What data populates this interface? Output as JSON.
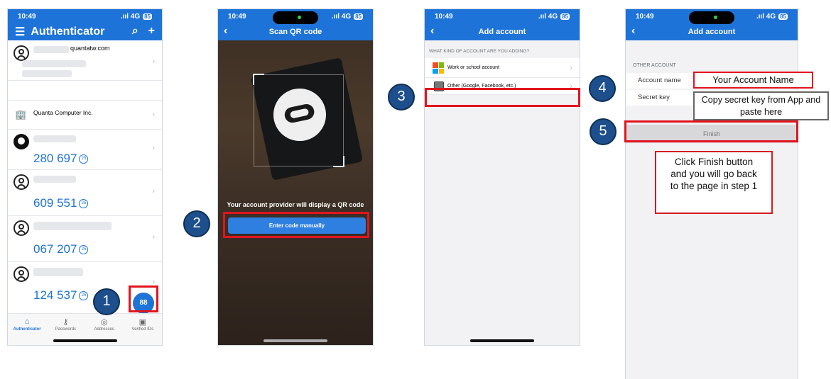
{
  "colors": {
    "brand_blue": "#1e73d8",
    "annotation_red": "#e1141e",
    "step_badge": "#1e4f8d"
  },
  "status": {
    "time": "10:49",
    "signal": ".ııl 4G",
    "battery": "85"
  },
  "phone1": {
    "title": "Authenticator",
    "icons": [
      "menu-icon",
      "search-icon",
      "add-icon"
    ],
    "accounts": [
      {
        "name_partial": "quantatw.com"
      },
      {
        "name": "Quanta Computer Inc."
      },
      {
        "code": "280 697",
        "timer": "25"
      },
      {
        "code": "609 551",
        "timer": "25"
      },
      {
        "code": "067 207",
        "timer": "25"
      },
      {
        "code": "124 537",
        "timer": "25"
      }
    ],
    "fab_glyph": "88",
    "tabs": [
      "Authenticator",
      "Passwords",
      "Addresses",
      "Verified IDs"
    ]
  },
  "phone2": {
    "title": "Scan QR code",
    "scan_hint": "Your account provider will display a QR code",
    "enter_manually": "Enter code manually"
  },
  "phone3": {
    "title": "Add account",
    "section": "WHAT KIND OF ACCOUNT ARE YOU ADDING?",
    "options": [
      "Work or school account",
      "Other (Google, Facebook, etc.)"
    ]
  },
  "phone4": {
    "title": "Add account",
    "section": "OTHER ACCOUNT",
    "account_name_label": "Account name",
    "secret_key_label": "Secret key",
    "account_name_value": "Your Account Name",
    "secret_key_hint": "Copy secret key from App and paste here",
    "finish": "Finish"
  },
  "annotations": {
    "steps": [
      "1",
      "2",
      "3",
      "4",
      "5"
    ],
    "finish_note": "Click Finish button and you will go back to the page in step 1"
  }
}
